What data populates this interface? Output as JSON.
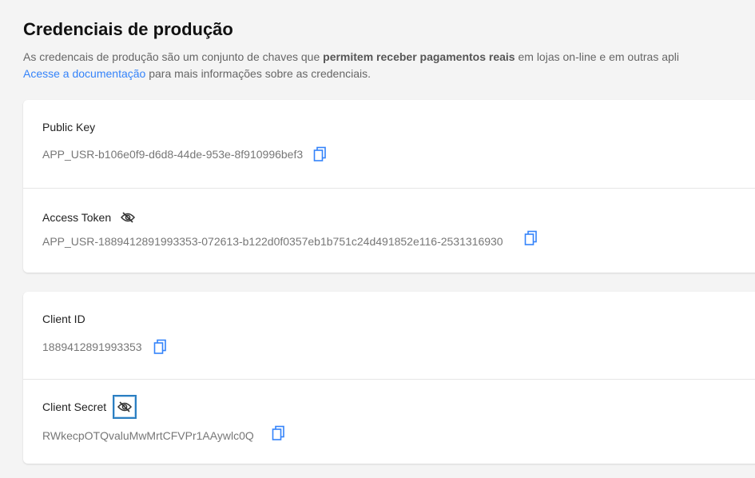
{
  "header": {
    "title": "Credenciais de produção",
    "desc_part1": "As credencais de produção são um conjunto de chaves que ",
    "desc_bold": "permitem receber pagamentos reais",
    "desc_part2": " em lojas on-line e em outras apli",
    "doc_link": "Acesse a documentação",
    "desc_part3": " para mais informações sobre as credenciais."
  },
  "cards": [
    {
      "rows": [
        {
          "label": "Public Key",
          "value": "APP_USR-b106e0f9-d6d8-44de-953e-8f910996bef3"
        },
        {
          "label": "Access Token",
          "value": "APP_USR-1889412891993353-072613-b122d0f0357eb1b751c24d491852e116-2531316930"
        }
      ]
    },
    {
      "rows": [
        {
          "label": "Client ID",
          "value": "1889412891993353"
        },
        {
          "label": "Client Secret",
          "value": "RWkecpOTQvaluMwMrtCFVPr1AAywlc0Q"
        }
      ]
    }
  ],
  "colors": {
    "accent": "#3483fa",
    "background": "#f4f4f4"
  }
}
